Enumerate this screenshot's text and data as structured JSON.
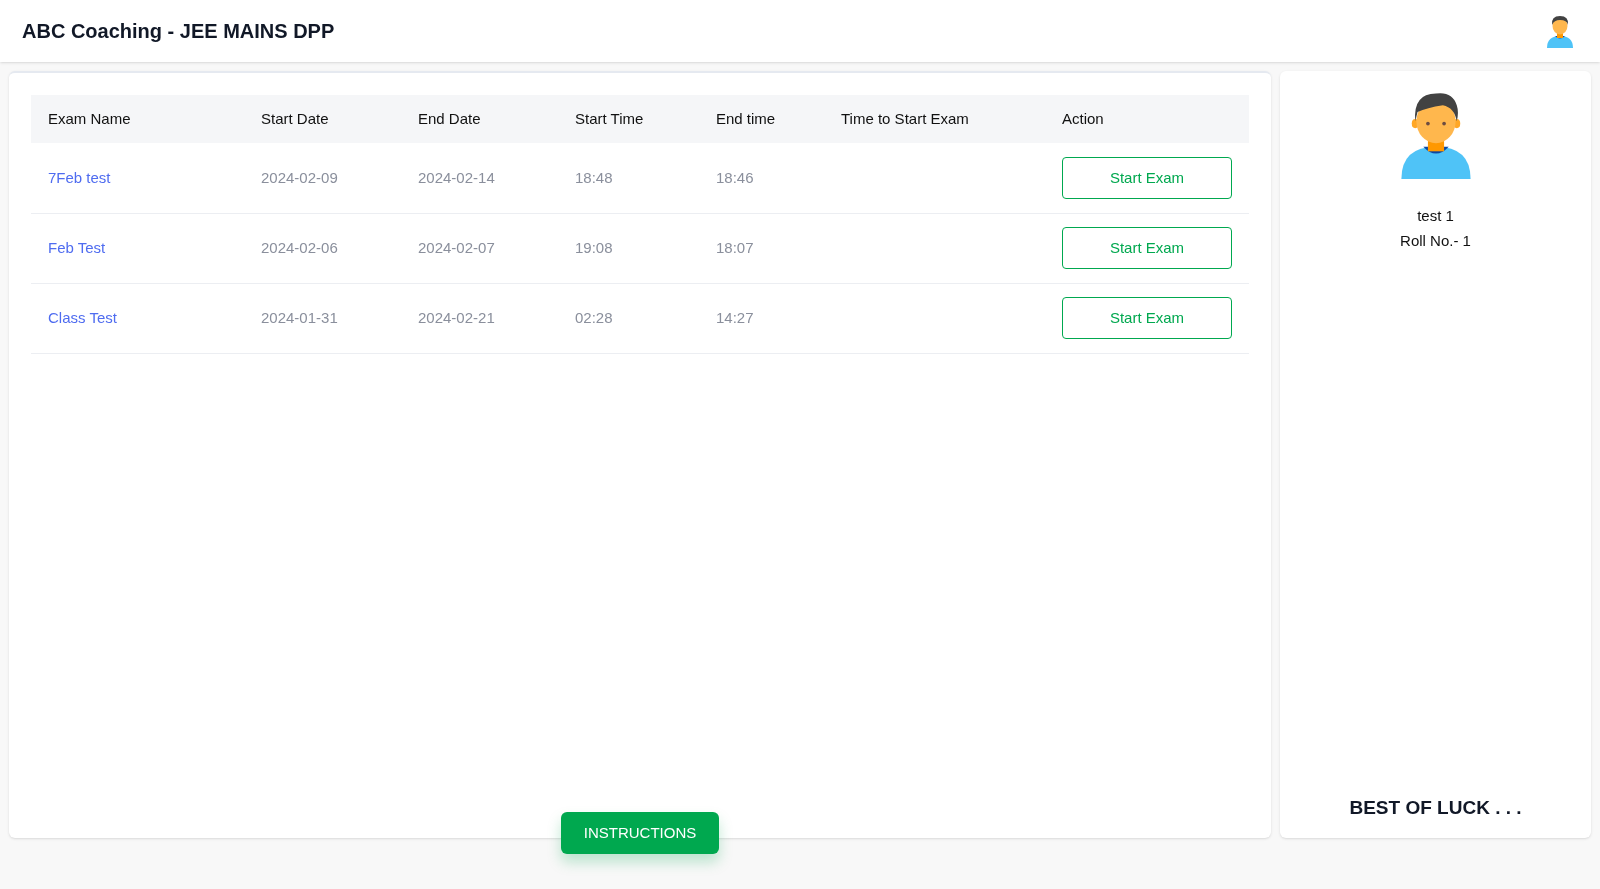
{
  "header": {
    "title": "ABC Coaching - JEE MAINS DPP"
  },
  "table": {
    "columns": [
      "Exam Name",
      "Start Date",
      "End Date",
      "Start Time",
      "End time",
      "Time to Start Exam",
      "Action"
    ],
    "rows": [
      {
        "exam_name": "7Feb test",
        "start_date": "2024-02-09",
        "end_date": "2024-02-14",
        "start_time": "18:48",
        "end_time": "18:46",
        "action": "Start Exam"
      },
      {
        "exam_name": "Feb Test",
        "start_date": "2024-02-06",
        "end_date": "2024-02-07",
        "start_time": "19:08",
        "end_time": "18:07",
        "action": "Start Exam"
      },
      {
        "exam_name": "Class Test",
        "start_date": "2024-01-31",
        "end_date": "2024-02-21",
        "start_time": "02:28",
        "end_time": "14:27",
        "action": "Start Exam"
      }
    ]
  },
  "instructions_button": "INSTRUCTIONS",
  "profile": {
    "name": "test 1",
    "roll": "Roll No.- 1",
    "footer": "BEST OF LUCK . . ."
  }
}
